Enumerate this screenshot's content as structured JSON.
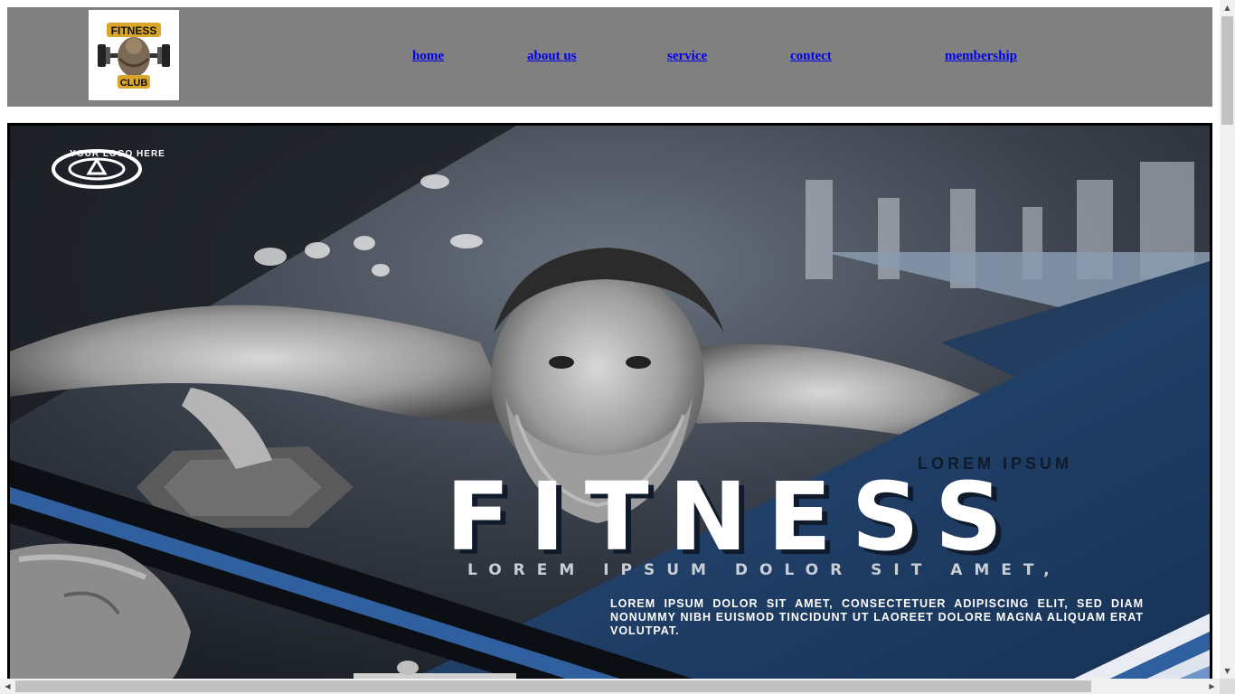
{
  "nav": {
    "logo": {
      "alt": "FITNESS CLUB",
      "line1": "FITNESS",
      "line2": "CLUB"
    },
    "links": [
      "home",
      "about us",
      "service",
      "contect",
      "membership"
    ]
  },
  "hero": {
    "brand_logo_text": "YOUR LOGO HERE",
    "overline": "LOREM IPSUM",
    "title": "FITNESS",
    "tagline": "LOREM IPSUM DOLOR SIT AMET,",
    "body": "LOREM IPSUM DOLOR SIT AMET, CONSECTETUER ADIPISCING ELIT, SED DIAM NONUMMY NIBH EUISMOD TINCIDUNT UT LAOREET DOLORE MAGNA ALIQUAM ERAT VOLUTPAT."
  },
  "colors": {
    "nav_bg": "#808080",
    "link": "#0000ee",
    "hero_blue": "#1e3f66",
    "hero_dark": "#0f1a2b",
    "stripe_blue": "#2f5f9e"
  },
  "scrollbars": {
    "vertical_up_icon": "triangle-up-icon",
    "vertical_down_icon": "triangle-down-icon",
    "horizontal_left_icon": "triangle-left-icon",
    "horizontal_right_icon": "triangle-right-icon"
  }
}
